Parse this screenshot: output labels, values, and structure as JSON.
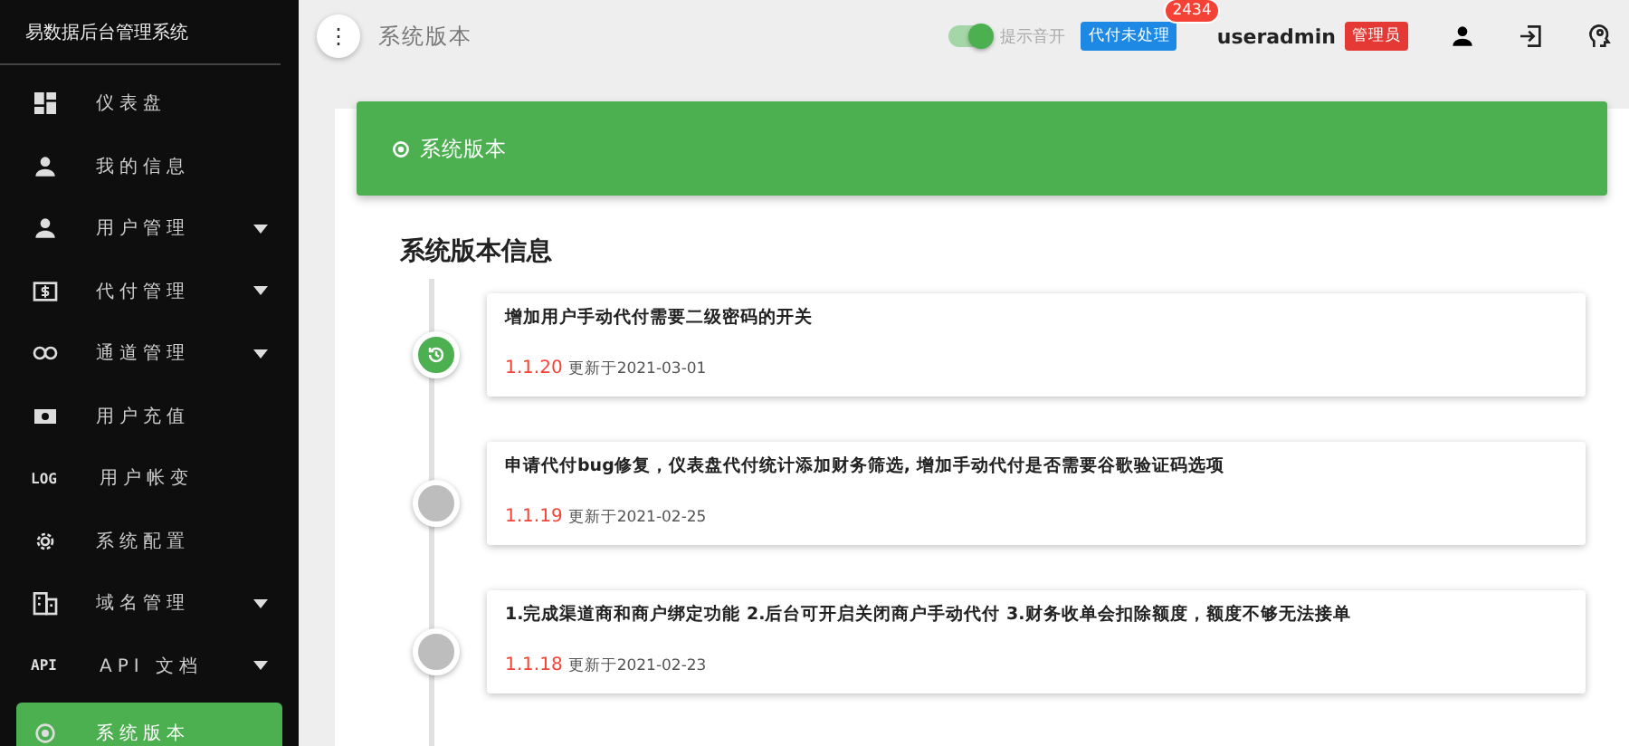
{
  "sidebar": {
    "title": "易数据后台管理系统",
    "items": [
      {
        "label": "仪表盘",
        "expandable": false,
        "selected": false
      },
      {
        "label": "我的信息",
        "expandable": false,
        "selected": false
      },
      {
        "label": "用户管理",
        "expandable": true,
        "selected": false
      },
      {
        "label": "代付管理",
        "expandable": true,
        "selected": false
      },
      {
        "label": "通道管理",
        "expandable": true,
        "selected": false
      },
      {
        "label": "用户充值",
        "expandable": false,
        "selected": false
      },
      {
        "label": "用户帐变",
        "icon_text": "LOG",
        "expandable": false,
        "selected": false
      },
      {
        "label": "系统配置",
        "expandable": false,
        "selected": false
      },
      {
        "label": "域名管理",
        "expandable": true,
        "selected": false
      },
      {
        "label": "API 文档",
        "icon_text": "API",
        "expandable": true,
        "selected": false
      },
      {
        "label": "系统版本",
        "expandable": false,
        "selected": true
      }
    ]
  },
  "header": {
    "menu_glyph": "⋮",
    "title": "系统版本",
    "sound_toggle": {
      "label": "提示音开",
      "on": true
    },
    "pending": {
      "label": "代付未处理",
      "count": "2434"
    },
    "username": "useradmin",
    "role": "管理员"
  },
  "banner": {
    "title": "系统版本"
  },
  "versions": {
    "heading": "系统版本信息",
    "items": [
      {
        "description": "增加用户手动代付需要二级密码的开关",
        "version": "1.1.20",
        "updated": "更新于2021-03-01",
        "current": true
      },
      {
        "description": "申请代付bug修复，仪表盘代付统计添加财务筛选, 增加手动代付是否需要谷歌验证码选项",
        "version": "1.1.19",
        "updated": "更新于2021-02-25",
        "current": false
      },
      {
        "description": "1.完成渠道商和商户绑定功能 2.后台可开启关闭商户手动代付 3.财务收单会扣除额度，额度不够无法接单",
        "version": "1.1.18",
        "updated": "更新于2021-02-23",
        "current": false
      }
    ]
  }
}
